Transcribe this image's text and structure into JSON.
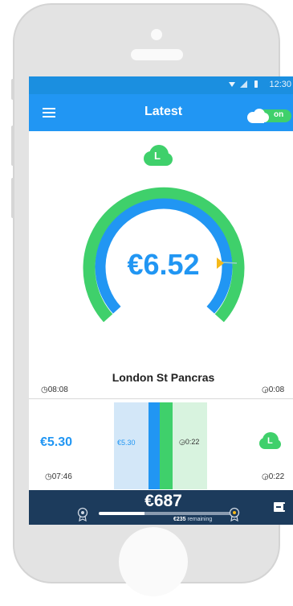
{
  "status_bar": {
    "time": "12:30",
    "icons": [
      "wifi-icon",
      "signal-icon",
      "battery-icon"
    ]
  },
  "app_bar": {
    "title": "Latest",
    "toggle_label": "on",
    "toggle_state": "on"
  },
  "gauge": {
    "badge": "L",
    "amount": "€6.52",
    "station": "London St Pancras",
    "start_time": "08:08",
    "duration": "0:08",
    "colors": {
      "outer": "#3fd06b",
      "inner": "#2196f3",
      "marker": "#f5b91a"
    }
  },
  "journey_panel": {
    "amount": "€5.30",
    "time": "07:46",
    "segment_amount": "€5.30",
    "segment_duration": "0:22",
    "badge": "L",
    "duration": "0:22"
  },
  "footer": {
    "total": "€687",
    "remaining_amount": "€235",
    "remaining_text": "remaining",
    "progress_fraction": 0.35
  },
  "colors": {
    "primary": "#2196f3",
    "accent": "#3fd06b",
    "footer": "#1c3b5c"
  }
}
